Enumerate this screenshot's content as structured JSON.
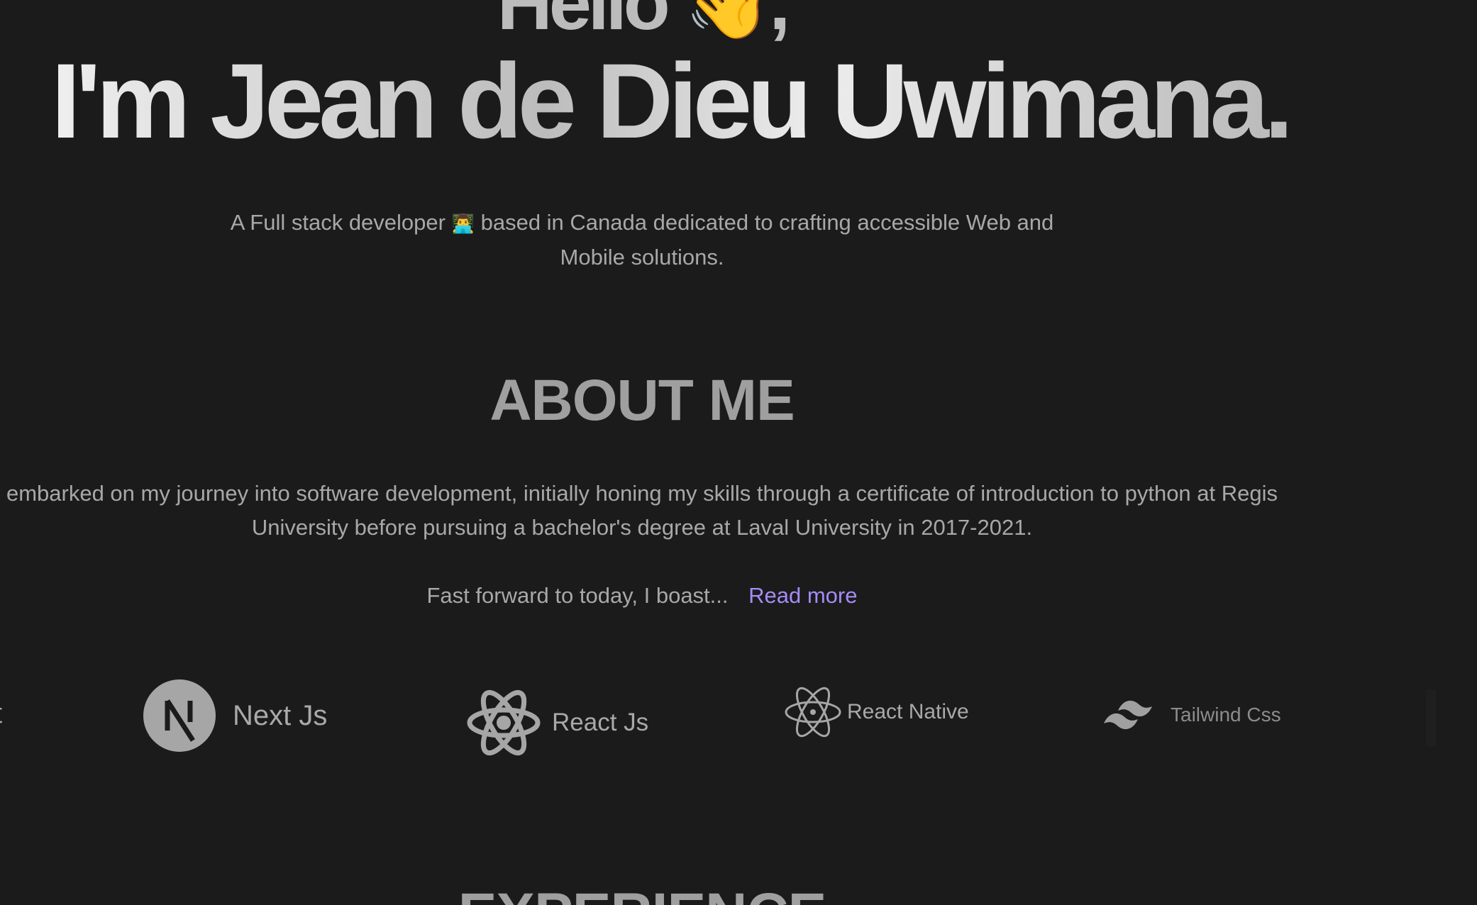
{
  "hero": {
    "greeting": "Hello",
    "wave_emoji": "👋",
    "greeting_suffix": ",",
    "name_line": "I'm Jean de Dieu Uwimana."
  },
  "intro": {
    "line_before_emoji": "A Full stack developer",
    "emoji": "👨‍💻",
    "line_after_emoji": "based in Canada dedicated to crafting accessible Web and Mobile solutions."
  },
  "about": {
    "heading": "ABOUT ME",
    "paragraph": "embarked on my journey into software development, initially honing my skills through a certificate of introduction to python at Regis University before pursuing a bachelor's degree at Laval University in 2017-2021.",
    "teaser": "Fast forward to today, I boast...",
    "read_more": "Read more"
  },
  "tech_stack": {
    "partial_prev_label": "t",
    "items": [
      {
        "label": "Next Js",
        "icon": "nextjs-icon"
      },
      {
        "label": "React Js",
        "icon": "react-icon"
      },
      {
        "label": "React Native",
        "icon": "react-native-icon"
      },
      {
        "label": "Tailwind Css",
        "icon": "tailwind-icon"
      }
    ]
  },
  "experience": {
    "heading": "EXPERIENCE"
  },
  "colors": {
    "background": "#1b1b1b",
    "text": "#a8a8a8",
    "accent_link": "#a58cf5"
  }
}
